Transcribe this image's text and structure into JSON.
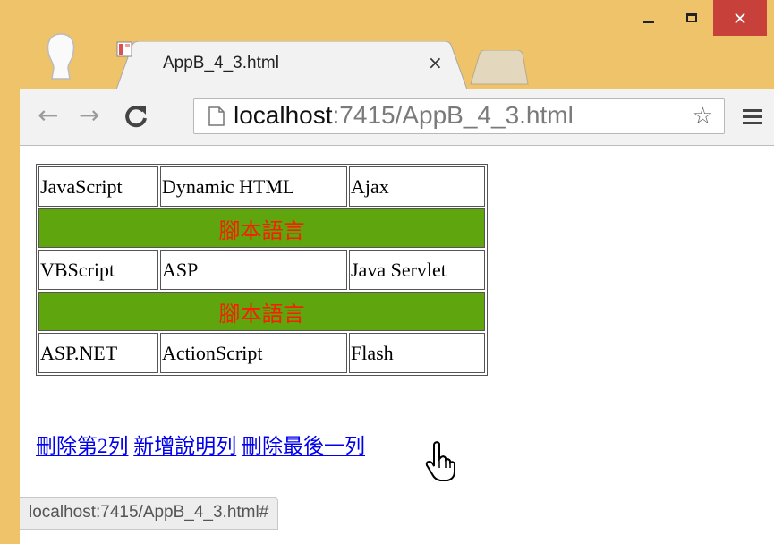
{
  "browser": {
    "tab_title": "AppB_4_3.html",
    "tab_close": "×",
    "url_host": "localhost",
    "url_rest": ":7415/AppB_4_3.html",
    "back_icon": "arrow-left-icon",
    "forward_icon": "arrow-right-icon",
    "reload_icon": "reload-icon",
    "star_icon": "star-icon",
    "menu_icon": "hamburger-menu-icon",
    "status_url": "localhost:7415/AppB_4_3.html#"
  },
  "window_controls": {
    "minimize": "minimize-icon",
    "maximize": "maximize-icon",
    "close": "×",
    "close_color": "#c7413a"
  },
  "table": {
    "rows": [
      [
        "JavaScript",
        "Dynamic HTML",
        "Ajax"
      ],
      [
        "腳本語言"
      ],
      [
        "VBScript",
        "ASP",
        "Java Servlet"
      ],
      [
        "腳本語言"
      ],
      [
        "ASP.NET",
        "ActionScript",
        "Flash"
      ]
    ],
    "banner_bg": "#5ea50e",
    "banner_text_color": "#ff1a00"
  },
  "links": {
    "delete_row2": "刪除第2列",
    "add_caption": "新增說明列",
    "delete_last": "刪除最後一列",
    "color": "#0000ee"
  },
  "colors": {
    "frame": "#efc36a"
  }
}
